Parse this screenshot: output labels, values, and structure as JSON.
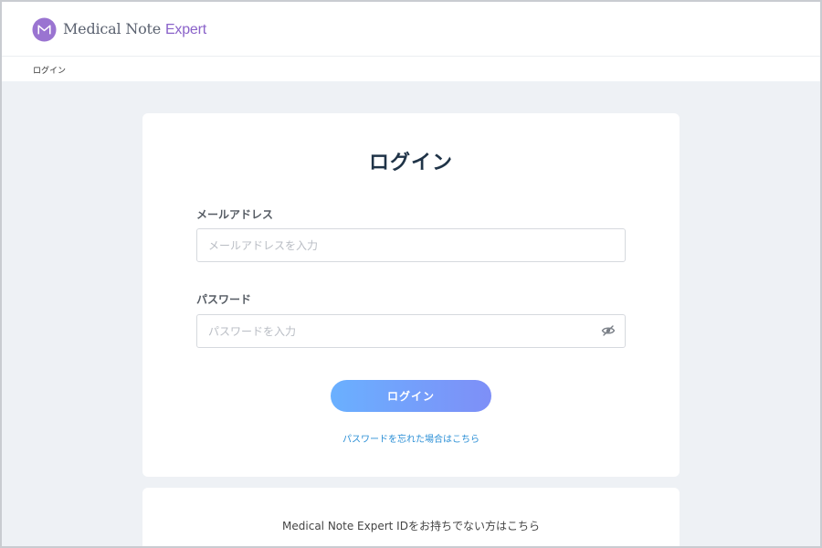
{
  "header": {
    "logo_name": "Medical Note",
    "logo_accent": "Expert",
    "brand_color": "#8a62c9"
  },
  "breadcrumb": {
    "current": "ログイン"
  },
  "login": {
    "title": "ログイン",
    "email": {
      "label": "メールアドレス",
      "value": "",
      "placeholder": "メールアドレスを入力"
    },
    "password": {
      "label": "パスワード",
      "value": "",
      "placeholder": "パスワードを入力",
      "toggle_icon": "eye-slash-icon"
    },
    "submit_label": "ログイン",
    "forgot_link": "パスワードを忘れた場合はこちら",
    "button_gradient": [
      "#6ab0ff",
      "#7e8ff7"
    ],
    "link_color": "#2b8fd6"
  },
  "register": {
    "text": "Medical Note Expert IDをお持ちでない方はこちら"
  }
}
